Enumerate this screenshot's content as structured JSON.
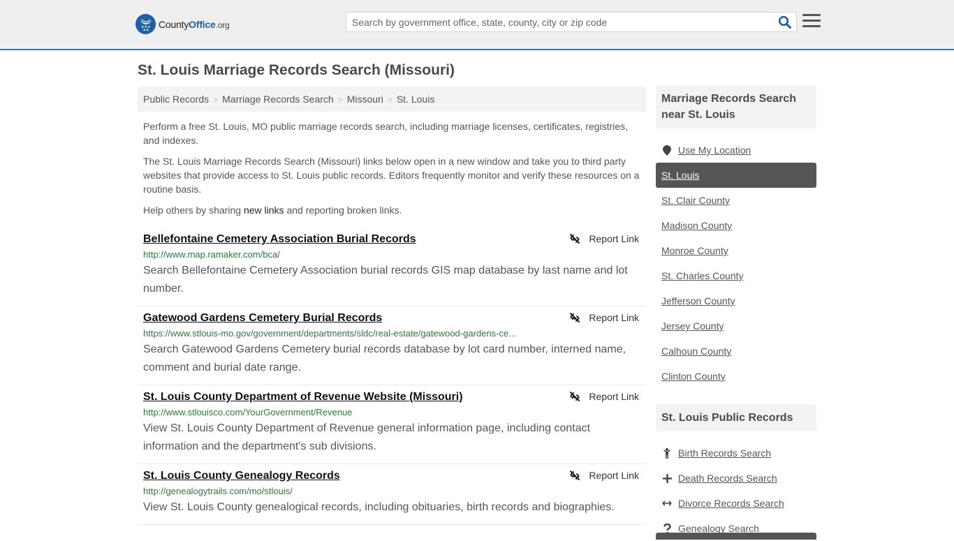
{
  "header": {
    "logo": {
      "name": "County",
      "office": "Office",
      "tld": ".org"
    },
    "search_placeholder": "Search by government office, state, county, city or zip code",
    "search_icon": "search-icon",
    "menu_icon": "hamburger-menu-icon",
    "accent_color": "#1f5fa4"
  },
  "page_title": "St. Louis Marriage Records Search (Missouri)",
  "breadcrumb": [
    {
      "label": "Public Records"
    },
    {
      "label": "Marriage Records Search"
    },
    {
      "label": "Missouri"
    },
    {
      "label": "St. Louis"
    }
  ],
  "breadcrumb_separator": ">",
  "intro": {
    "p1": "Perform a free St. Louis, MO public marriage records search, including marriage licenses, certificates, registries, and indexes.",
    "p2": "The St. Louis Marriage Records Search (Missouri) links below open in a new window and take you to third party websites that provide access to St. Louis public records. Editors frequently monitor and verify these resources on a routine basis.",
    "p3_before": "Help others by sharing ",
    "p3_link": "new links",
    "p3_after": " and reporting broken links."
  },
  "report_label": "Report Link",
  "results": [
    {
      "title": "Bellefontaine Cemetery Association Burial Records",
      "url": "http://www.map.ramaker.com/bca/",
      "description": "Search Bellefontaine Cemetery Association burial records GIS map database by last name and lot number."
    },
    {
      "title": "Gatewood Gardens Cemetery Burial Records",
      "url": "https://www.stlouis-mo.gov/government/departments/sldc/real-estate/gatewood-gardens-ce...",
      "description": "Search Gatewood Gardens Cemetery burial records database by lot card number, interned name, comment and burial date range."
    },
    {
      "title": "St. Louis County Department of Revenue Website (Missouri)",
      "url": "http://www.stlouisco.com/YourGovernment/Revenue",
      "description": "View St. Louis County Department of Revenue general information page, including contact information and the department's sub divisions."
    },
    {
      "title": "St. Louis County Genealogy Records",
      "url": "http://genealogytrails.com/mo/stlouis/",
      "description": "View St. Louis County genealogical records, including obituaries, birth records and biographies."
    }
  ],
  "sidebar": {
    "nearby_title": "Marriage Records Search near St. Louis",
    "use_location": "Use My Location",
    "nearby": [
      {
        "label": "St. Louis",
        "active": true
      },
      {
        "label": "St. Clair County"
      },
      {
        "label": "Madison County"
      },
      {
        "label": "Monroe County"
      },
      {
        "label": "St. Charles County"
      },
      {
        "label": "Jefferson County"
      },
      {
        "label": "Jersey County"
      },
      {
        "label": "Calhoun County"
      },
      {
        "label": "Clinton County"
      }
    ],
    "public_title": "St. Louis Public Records",
    "public": [
      {
        "label": "Birth Records Search",
        "icon": "child-icon"
      },
      {
        "label": "Death Records Search",
        "icon": "cross-icon"
      },
      {
        "label": "Divorce Records Search",
        "icon": "left-right-arrow-icon"
      },
      {
        "label": "Genealogy Search",
        "icon": "question-icon"
      }
    ]
  }
}
